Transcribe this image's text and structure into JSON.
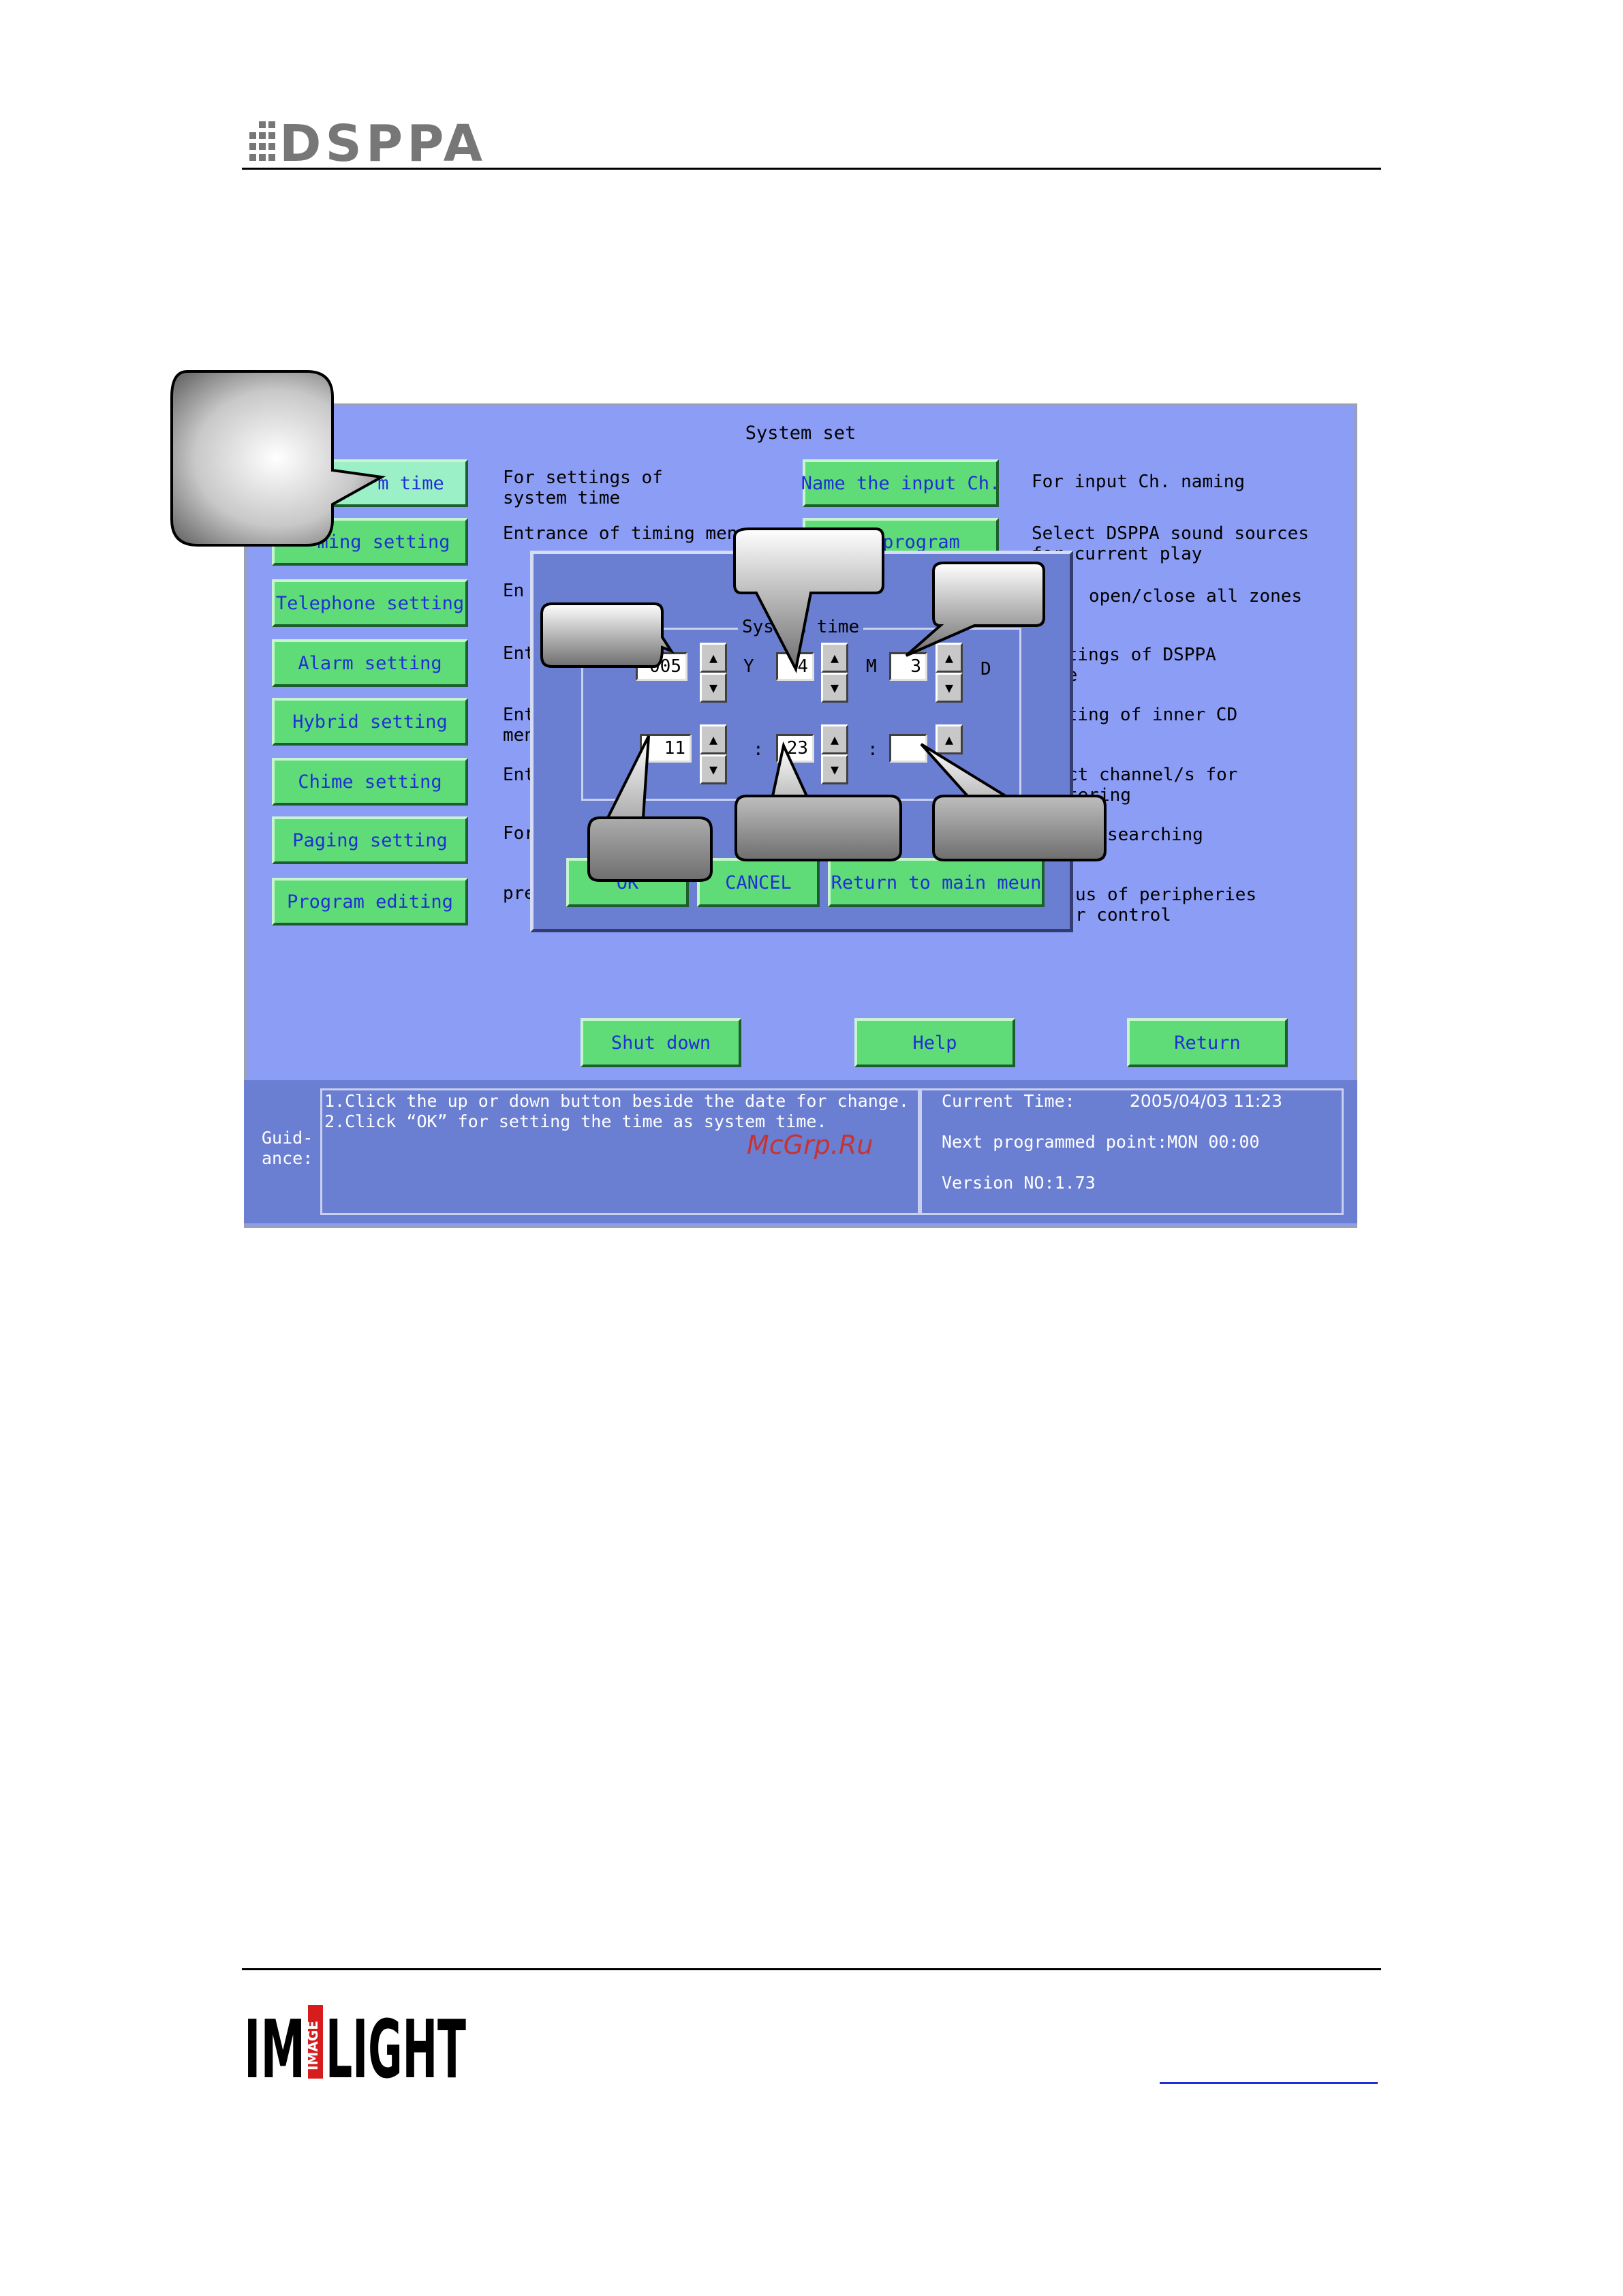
{
  "header": {
    "logo_text": "DSPPA"
  },
  "footer": {
    "logo_text": "IMAGELIGHT"
  },
  "screen": {
    "title": "System set",
    "left_buttons": [
      {
        "label": "System time",
        "visible": "m time",
        "desc": "For settings of\nsystem time",
        "selected": true
      },
      {
        "label": "Timing setting",
        "visible": "ming setting",
        "desc": "Entrance of timing menu"
      },
      {
        "label": "Telephone setting",
        "desc": "En"
      },
      {
        "label": "Alarm setting",
        "desc": "Ent"
      },
      {
        "label": "Hybrid setting",
        "desc": "Ent\nmen"
      },
      {
        "label": "Chime setting",
        "desc": "Ent"
      },
      {
        "label": "Paging setting",
        "desc": "For"
      },
      {
        "label": "Program editing",
        "desc": "pre"
      }
    ],
    "right_buttons": [
      {
        "label": "Name the input Ch.",
        "desc": "For input Ch. naming"
      },
      {
        "label": "program",
        "desc": "Select DSPPA sound sources\nfor current play"
      }
    ],
    "right_descs": [
      "open/close all zones",
      "atings of DSPPA\nce",
      "ating of inner CD",
      "ct channel/s for\ntering",
      "es searching",
      "us of peripheries\nr control"
    ],
    "bottom_buttons": [
      "Shut down",
      "Help",
      "Return"
    ]
  },
  "dialog": {
    "title": "System time",
    "year": "2005",
    "year_visible": "005",
    "month": "4",
    "day": "3",
    "hour": "11",
    "minute": "23",
    "second": "",
    "unit_y": "Y",
    "unit_m": "M",
    "unit_d": "D",
    "sep": ":",
    "ok_label": "OK",
    "cancel_label": "CANCEL",
    "return_label": "Return to main meun"
  },
  "guidance": {
    "label": "Guid-\nance:",
    "lines": "1.Click the up or down button beside the date for change.\n2.Click “OK” for setting the time as system time.",
    "current_time_label": "Current Time:",
    "current_time_value": "2005/04/03 11:23",
    "next_point": "Next programmed point:MON 00:00",
    "version": "Version NO:1.73"
  },
  "watermark": "McGrp.Ru"
}
